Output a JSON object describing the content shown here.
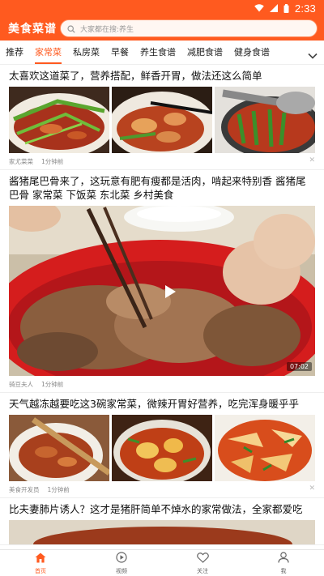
{
  "status_bar": {
    "time": "2:33"
  },
  "app": {
    "logo": "美食菜谱",
    "search_placeholder": "大家都在搜:养生"
  },
  "tabs": [
    "推荐",
    "家常菜",
    "私房菜",
    "早餐",
    "养生食谱",
    "减肥食谱",
    "健身食谱"
  ],
  "active_tab": "家常菜",
  "feed": [
    {
      "title": "太喜欢这道菜了，营养搭配，鲜香开胃，做法还这么简单",
      "author": "家尤菜菜",
      "time": "1分钟前"
    },
    {
      "title": "酱猪尾巴骨来了，这玩意有肥有瘦都是活肉，啃起来特别香 酱猪尾巴骨 家常菜 下饭菜 东北菜 乡村美食",
      "author": "骑豆夫人",
      "time": "1分钟前",
      "duration": "07:02"
    },
    {
      "title": "天气越冻越要吃这3碗家常菜，微辣开胃好营养，吃完浑身暖乎乎",
      "author": "美食开发员",
      "time": "1分钟前"
    },
    {
      "title": "比夫妻肺片诱人？这才是猪肝简单不焯水的家常做法，全家都爱吃"
    }
  ],
  "bottom_nav": [
    {
      "label": "首页",
      "icon": "home-icon"
    },
    {
      "label": "视频",
      "icon": "play-circle-icon"
    },
    {
      "label": "关注",
      "icon": "heart-icon"
    },
    {
      "label": "我",
      "icon": "person-icon"
    }
  ],
  "colors": {
    "brand": "#ff5a1f",
    "text": "#222222",
    "meta": "#888888"
  }
}
